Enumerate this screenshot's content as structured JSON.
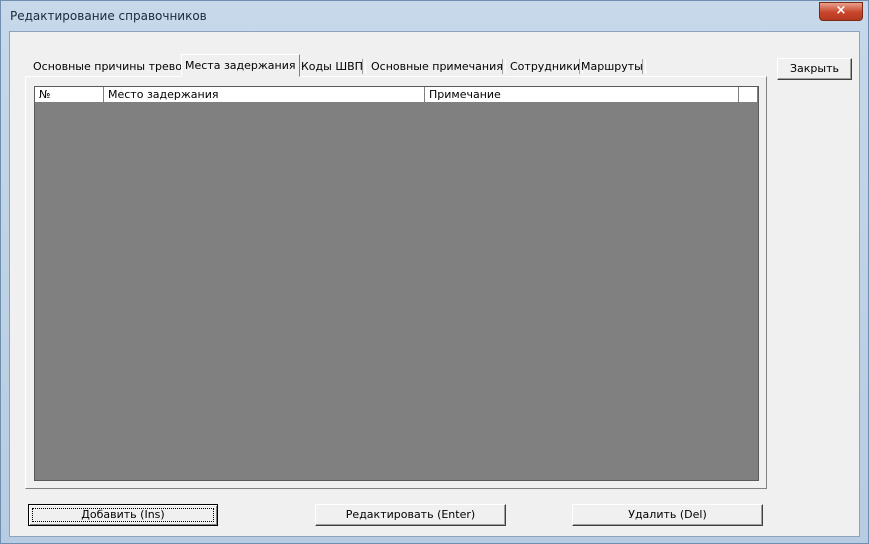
{
  "window": {
    "title": "Редактирование справочников",
    "close_glyph": "×"
  },
  "tabs": [
    {
      "label": "Основные причины тревог",
      "active": false
    },
    {
      "label": "Места задержания",
      "active": true
    },
    {
      "label": "Коды ШВП",
      "active": false
    },
    {
      "label": "Основные примечания",
      "active": false
    },
    {
      "label": "Сотрудники",
      "active": false
    },
    {
      "label": "Маршруты",
      "active": false
    }
  ],
  "grid": {
    "columns": [
      "№",
      "Место задержания",
      "Примечание",
      ""
    ],
    "rows": []
  },
  "buttons": {
    "close": "Закрыть",
    "add": "Добавить (Ins)",
    "edit": "Редактировать (Enter)",
    "delete": "Удалить (Del)"
  }
}
